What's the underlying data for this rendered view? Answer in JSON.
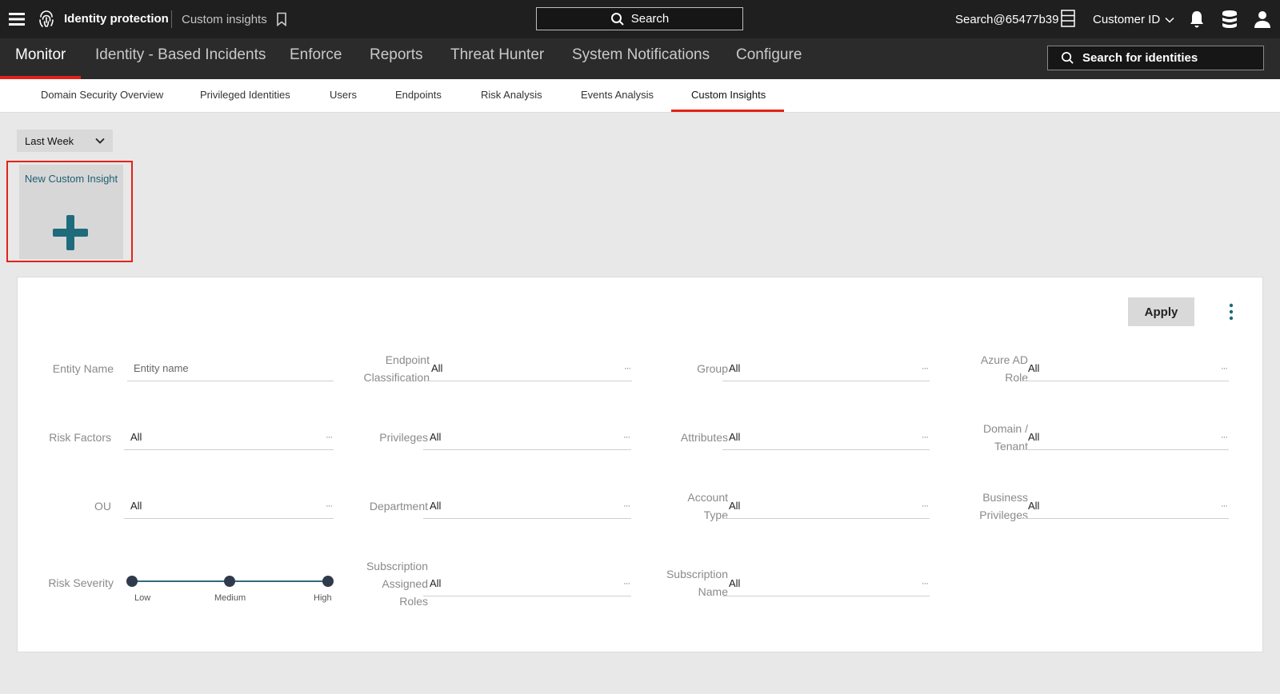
{
  "topbar": {
    "menu_icon": "hamburger-menu-icon",
    "logo_icon": "fingerprint-logo-icon",
    "app_title": "Identity protection",
    "breadcrumb": "Custom insights",
    "bookmark_icon": "bookmark-icon",
    "search_label": "Search",
    "user": "Search@65477b39",
    "customer_label": "Customer ID",
    "icons": [
      "server-icon",
      "bell-icon",
      "stack-icon",
      "user-icon"
    ]
  },
  "main_nav": {
    "items": [
      {
        "label": "Monitor",
        "active": true
      },
      {
        "label": "Identity - Based Incidents"
      },
      {
        "label": "Enforce"
      },
      {
        "label": "Reports"
      },
      {
        "label": "Threat Hunter"
      },
      {
        "label": "System Notifications"
      },
      {
        "label": "Configure"
      }
    ],
    "identity_search_placeholder": "Search for identities"
  },
  "sub_tabs": {
    "items": [
      {
        "label": "Domain Security Overview"
      },
      {
        "label": "Privileged Identities"
      },
      {
        "label": "Users"
      },
      {
        "label": "Endpoints"
      },
      {
        "label": "Risk Analysis"
      },
      {
        "label": "Events Analysis"
      },
      {
        "label": "Custom Insights",
        "active": true
      }
    ]
  },
  "period": {
    "value": "Last Week"
  },
  "new_card": {
    "label": "New Custom Insight"
  },
  "panel": {
    "apply_label": "Apply",
    "more_glyph": "···",
    "filters": {
      "entity_name": {
        "label": "Entity Name",
        "placeholder": "Entity name"
      },
      "endpoint_classification": {
        "label_line1": "Endpoint",
        "label_line2": "Classification",
        "value": "All"
      },
      "group": {
        "label": "Group",
        "value": "All"
      },
      "azure_ad_role": {
        "label_line1": "Azure AD",
        "label_line2": "Role",
        "value": "All"
      },
      "risk_factors": {
        "label": "Risk Factors",
        "value": "All"
      },
      "privileges": {
        "label": "Privileges",
        "value": "All"
      },
      "attributes": {
        "label": "Attributes",
        "value": "All"
      },
      "domain_tenant": {
        "label_line1": "Domain /",
        "label_line2": "Tenant",
        "value": "All"
      },
      "ou": {
        "label": "OU",
        "value": "All"
      },
      "department": {
        "label": "Department",
        "value": "All"
      },
      "account_type": {
        "label_line1": "Account",
        "label_line2": "Type",
        "value": "All"
      },
      "business_privileges": {
        "label_line1": "Business",
        "label_line2": "Privileges",
        "value": "All"
      },
      "subscription_assigned_roles": {
        "label_line1": "Subscription",
        "label_line2": "Assigned",
        "label_line3": "Roles",
        "value": "All"
      },
      "subscription_name": {
        "label_line1": "Subscription",
        "label_line2": "Name",
        "value": "All"
      }
    },
    "risk_severity": {
      "label": "Risk Severity",
      "levels": [
        "Low",
        "Medium",
        "High"
      ],
      "selected": [
        "Low",
        "Medium",
        "High"
      ]
    }
  },
  "colors": {
    "topbar_bg": "#1f1f1f",
    "nav_bg": "#2b2b2b",
    "accent_red": "#e2231a",
    "teal": "#1e6b7b",
    "page_bg": "#e8e8e8"
  }
}
